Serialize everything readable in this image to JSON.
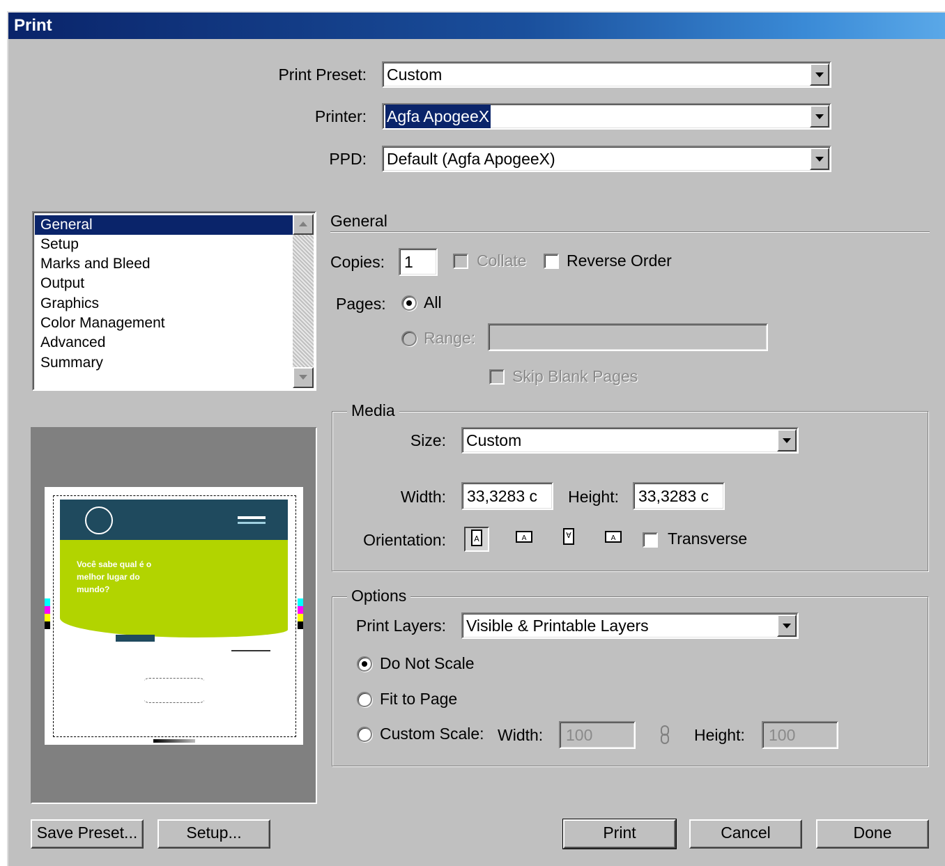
{
  "window": {
    "title": "Print"
  },
  "top": {
    "print_preset_label": "Print Preset:",
    "print_preset_value": "Custom",
    "printer_label": "Printer:",
    "printer_value": "Agfa ApogeeX",
    "ppd_label": "PPD:",
    "ppd_value": "Default (Agfa ApogeeX)"
  },
  "sidebar": {
    "items": [
      {
        "label": "General",
        "selected": true
      },
      {
        "label": "Setup"
      },
      {
        "label": "Marks and Bleed"
      },
      {
        "label": "Output"
      },
      {
        "label": "Graphics"
      },
      {
        "label": "Color Management"
      },
      {
        "label": "Advanced"
      },
      {
        "label": "Summary"
      }
    ]
  },
  "preview": {
    "headline": "Você sabe qual é o melhor lugar do mundo?"
  },
  "general": {
    "section_title": "General",
    "copies_label": "Copies:",
    "copies_value": "1",
    "collate_label": "Collate",
    "reverse_order_label": "Reverse Order",
    "pages_label": "Pages:",
    "all_label": "All",
    "range_label": "Range:",
    "range_value": "",
    "skip_blank_label": "Skip Blank Pages"
  },
  "media": {
    "title": "Media",
    "size_label": "Size:",
    "size_value": "Custom",
    "width_label": "Width:",
    "width_value": "33,3283 c",
    "height_label": "Height:",
    "height_value": "33,3283 c",
    "orientation_label": "Orientation:",
    "transverse_label": "Transverse"
  },
  "options": {
    "title": "Options",
    "print_layers_label": "Print Layers:",
    "print_layers_value": "Visible & Printable Layers",
    "do_not_scale_label": "Do Not Scale",
    "fit_to_page_label": "Fit to Page",
    "custom_scale_label": "Custom Scale:",
    "scale_width_label": "Width:",
    "scale_width_value": "100",
    "scale_height_label": "Height:",
    "scale_height_value": "100"
  },
  "buttons": {
    "save_preset": "Save Preset...",
    "setup": "Setup...",
    "print": "Print",
    "cancel": "Cancel",
    "done": "Done"
  }
}
